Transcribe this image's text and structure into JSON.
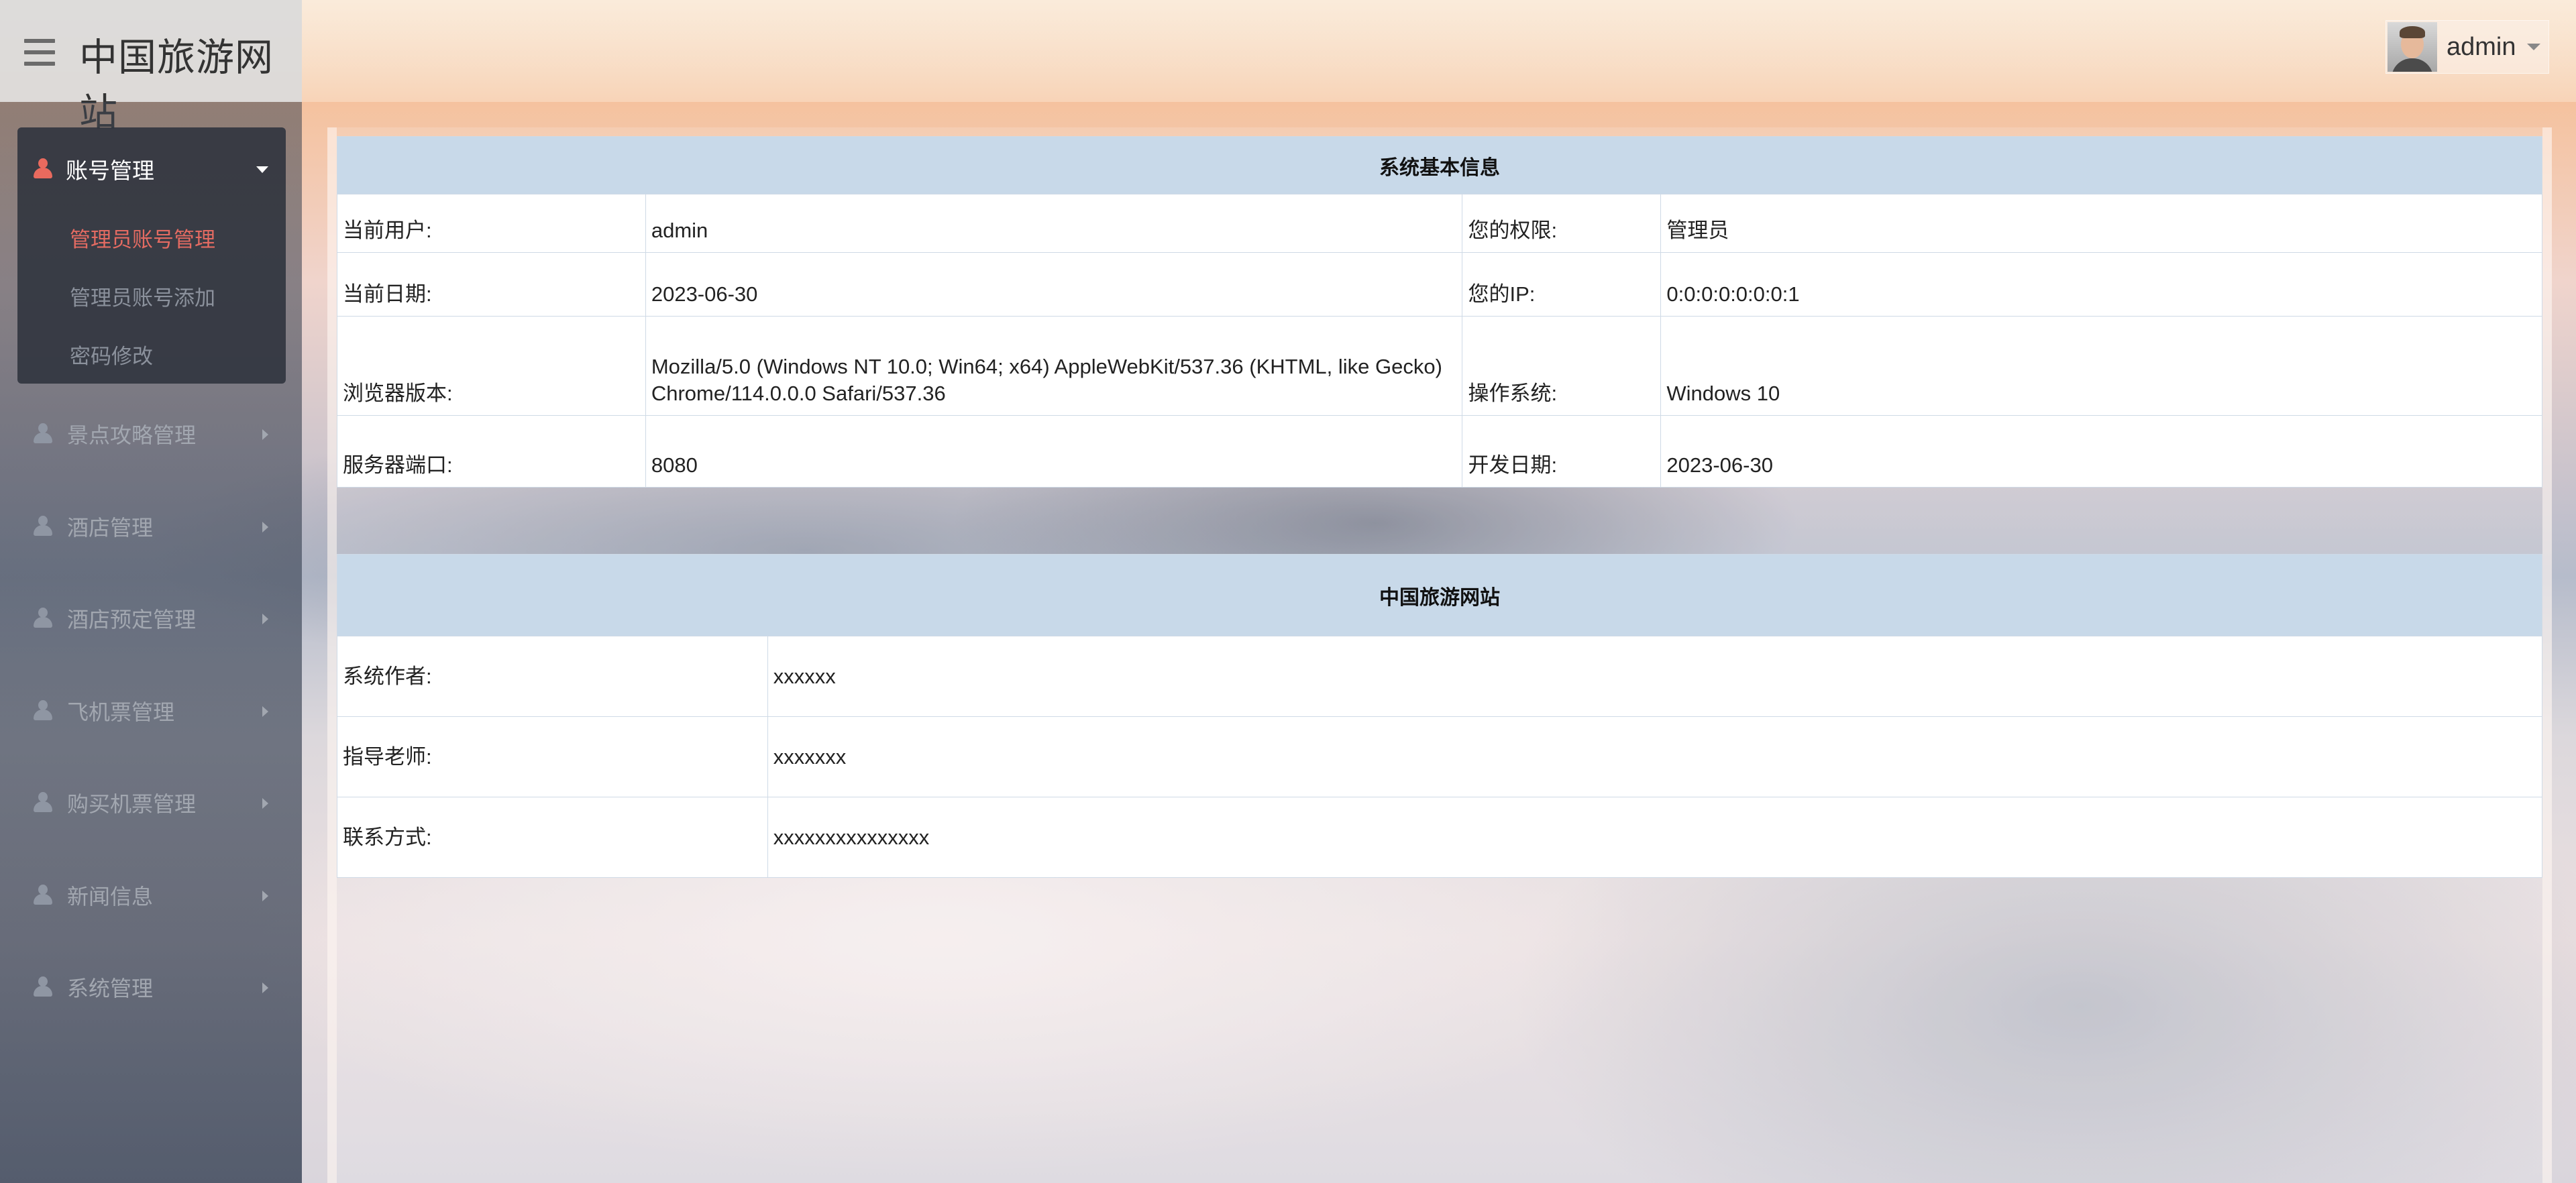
{
  "app": {
    "title": "中国旅游网站"
  },
  "user": {
    "name": "admin"
  },
  "sidebar": {
    "open_group": {
      "label": "账号管理",
      "items": [
        "管理员账号管理",
        "管理员账号添加",
        "密码修改"
      ]
    },
    "groups": [
      "景点攻略管理",
      "酒店管理",
      "酒店预定管理",
      "飞机票管理",
      "购买机票管理",
      "新闻信息",
      "系统管理"
    ]
  },
  "system_info": {
    "title": "系统基本信息",
    "rows": [
      {
        "label1": "当前用户:",
        "value1": "admin",
        "label2": "您的权限:",
        "value2": "管理员"
      },
      {
        "label1": "当前日期:",
        "value1": "2023-06-30",
        "label2": "您的IP:",
        "value2": "0:0:0:0:0:0:0:1"
      },
      {
        "label1": "浏览器版本:",
        "value1": "Mozilla/5.0 (Windows NT 10.0; Win64; x64) AppleWebKit/537.36 (KHTML, like Gecko) Chrome/114.0.0.0 Safari/537.36",
        "label2": "操作系统:",
        "value2": "Windows 10"
      },
      {
        "label1": "服务器端口:",
        "value1": "8080",
        "label2": "开发日期:",
        "value2": "2023-06-30"
      }
    ]
  },
  "site_info": {
    "title": "中国旅游网站",
    "rows": [
      {
        "label": "系统作者:",
        "value": "xxxxxx"
      },
      {
        "label": "指导老师:",
        "value": "xxxxxxx"
      },
      {
        "label": "联系方式:",
        "value": "xxxxxxxxxxxxxxx"
      }
    ]
  },
  "colors": {
    "accent": "#e96a5e",
    "table_header": "#c8d9e9",
    "sidebar_dark": "#30343e"
  }
}
